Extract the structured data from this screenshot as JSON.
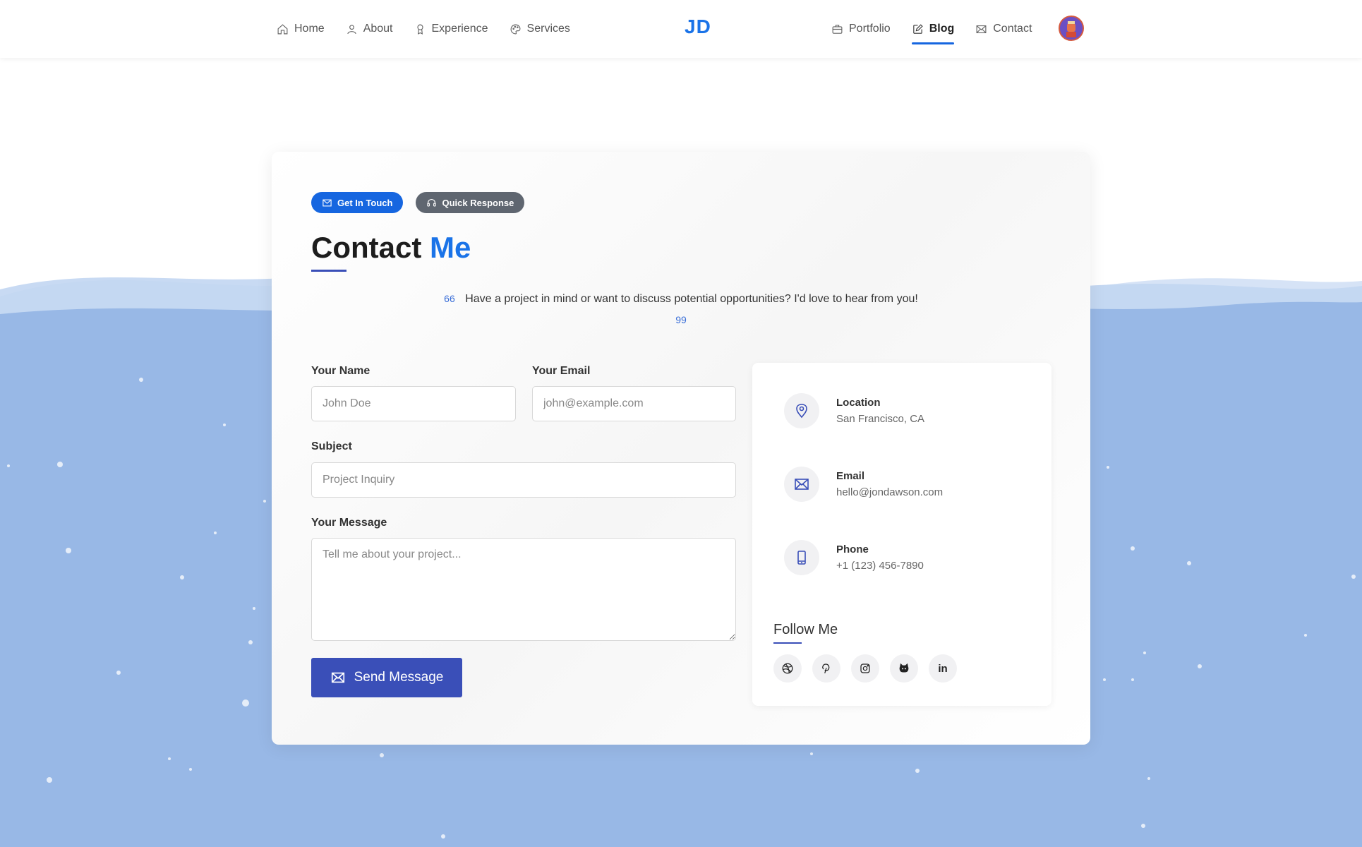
{
  "nav": {
    "left": [
      {
        "label": "Home",
        "icon": "home-icon"
      },
      {
        "label": "About",
        "icon": "user-icon"
      },
      {
        "label": "Experience",
        "icon": "award-icon"
      },
      {
        "label": "Services",
        "icon": "palette-icon"
      }
    ],
    "right": [
      {
        "label": "Portfolio",
        "icon": "briefcase-icon"
      },
      {
        "label": "Blog",
        "icon": "edit-icon",
        "active": true
      },
      {
        "label": "Contact",
        "icon": "mail-icon"
      }
    ],
    "brand": "JD"
  },
  "badges": {
    "get_in_touch": "Get In Touch",
    "quick_response": "Quick Response"
  },
  "heading": {
    "main": "Contact",
    "accent": "Me"
  },
  "quote": {
    "open_mark": "66",
    "text": "Have a project in mind or want to discuss potential opportunities? I'd love to hear from you!",
    "close_mark": "99"
  },
  "form": {
    "name_label": "Your Name",
    "name_placeholder": "John Doe",
    "email_label": "Your Email",
    "email_placeholder": "john@example.com",
    "subject_label": "Subject",
    "subject_placeholder": "Project Inquiry",
    "message_label": "Your Message",
    "message_placeholder": "Tell me about your project...",
    "send_label": "Send Message"
  },
  "contact_info": {
    "location_title": "Location",
    "location_value": "San Francisco, CA",
    "email_title": "Email",
    "email_value": "hello@jondawson.com",
    "phone_title": "Phone",
    "phone_value": "+1 (123) 456-7890"
  },
  "follow": {
    "title": "Follow Me",
    "icons": [
      "dribbble-icon",
      "pinterest-icon",
      "instagram-icon",
      "github-icon",
      "linkedin-icon"
    ],
    "linkedin_text": "in"
  },
  "colors": {
    "accent": "#1a73e8",
    "button": "#3a4fb8",
    "water": "#98b8e6"
  }
}
